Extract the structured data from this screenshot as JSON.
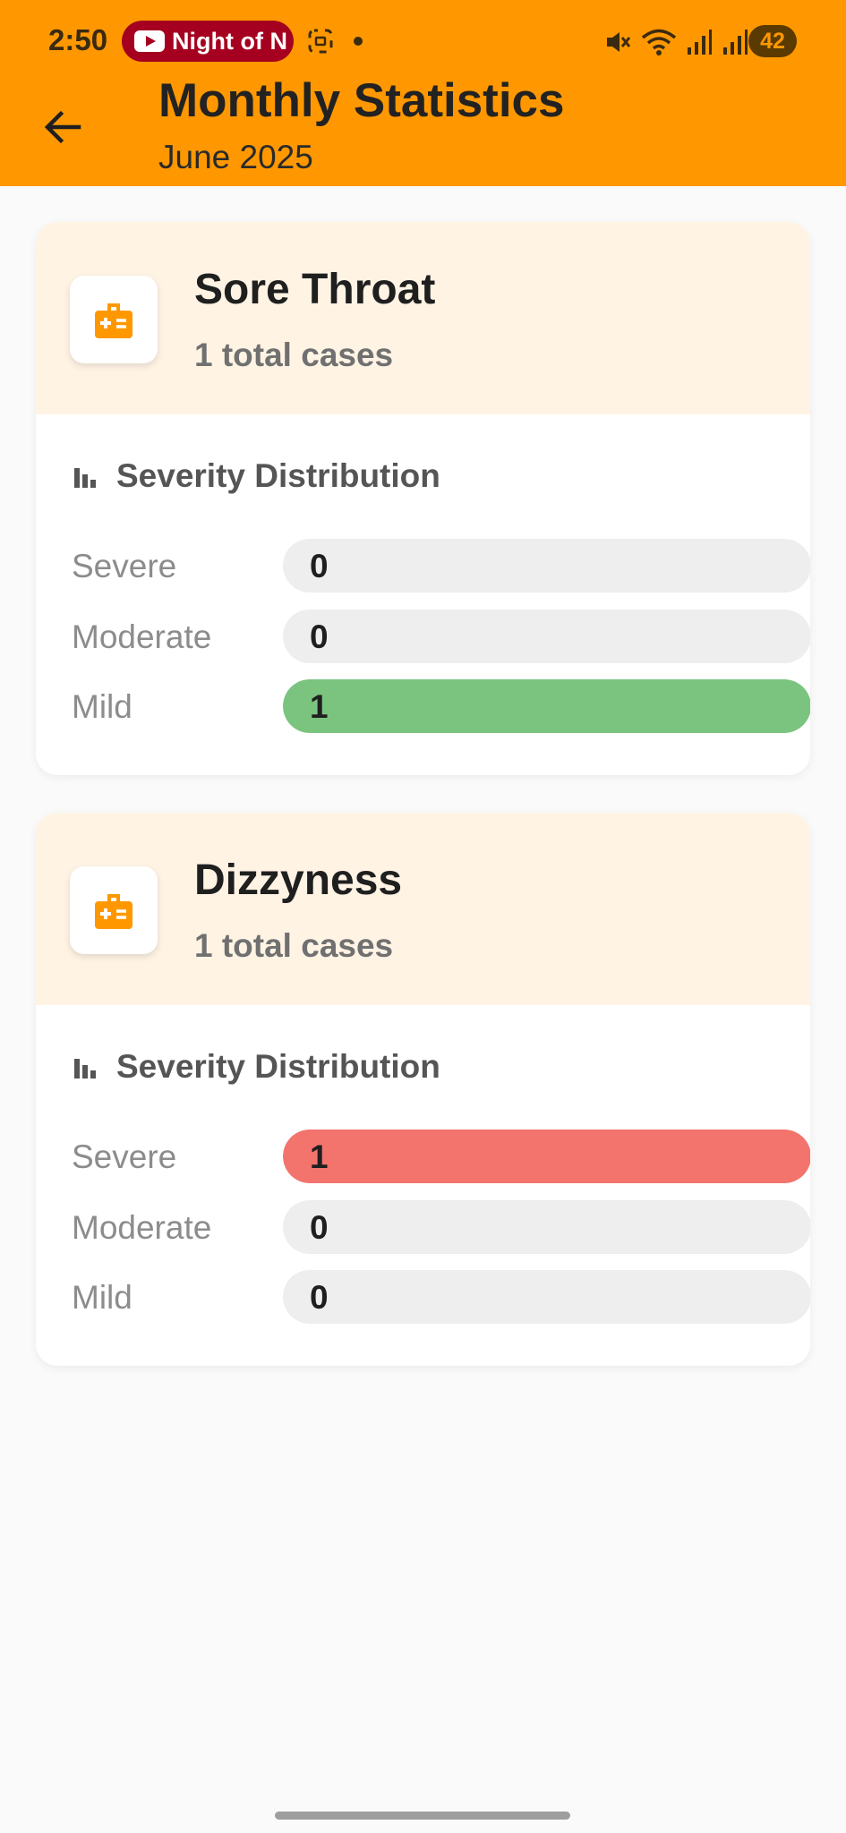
{
  "status_bar": {
    "time": "2:50",
    "media_chip": "Night of N",
    "battery": "42"
  },
  "header": {
    "title": "Monthly Statistics",
    "subtitle": "June 2025"
  },
  "cards": [
    {
      "name": "Sore Throat",
      "total": "1 total cases",
      "section_title": "Severity Distribution",
      "rows": [
        {
          "label": "Severe",
          "count": "0",
          "fraction": 0,
          "color": "#ef7369"
        },
        {
          "label": "Moderate",
          "count": "0",
          "fraction": 0,
          "color": "#ffb74d"
        },
        {
          "label": "Mild",
          "count": "1",
          "fraction": 1,
          "color": "#7bc47f"
        }
      ]
    },
    {
      "name": "Dizzyness",
      "total": "1 total cases",
      "section_title": "Severity Distribution",
      "rows": [
        {
          "label": "Severe",
          "count": "1",
          "fraction": 1,
          "color": "#f2746d"
        },
        {
          "label": "Moderate",
          "count": "0",
          "fraction": 0,
          "color": "#ffb74d"
        },
        {
          "label": "Mild",
          "count": "0",
          "fraction": 0,
          "color": "#7bc47f"
        }
      ]
    }
  ],
  "colors": {
    "accent": "#ff9800",
    "card_header": "#fff3e4"
  }
}
